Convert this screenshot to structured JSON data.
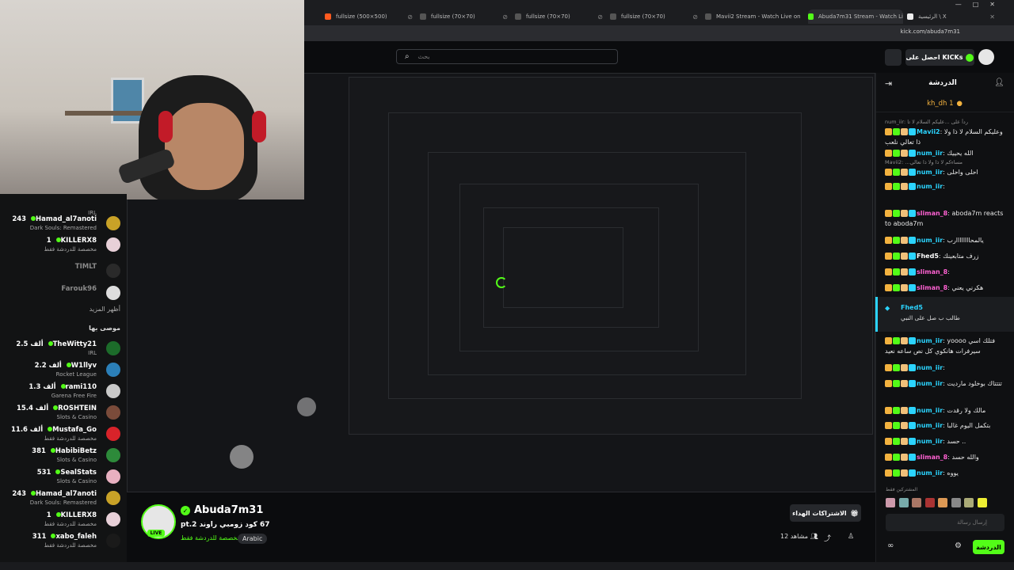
{
  "browser": {
    "tabs": [
      {
        "label": "fullsize (500×500)",
        "color": "#ff5a1f"
      },
      {
        "label": "fullsize (70×70)",
        "color": "#9aa0a6"
      },
      {
        "label": "fullsize (70×70)",
        "color": "#9aa0a6"
      },
      {
        "label": "fullsize (70×70)",
        "color": "#9aa0a6"
      },
      {
        "label": "Mavii2 Stream - Watch Live on",
        "color": "#9aa0a6"
      },
      {
        "label": "Abuda7m31 Stream - Watch Li",
        "color": "#53fc18"
      },
      {
        "label": "الرئيسية \\ X",
        "color": "#ffffff"
      }
    ],
    "url": "kick.com/abuda7m31"
  },
  "header": {
    "search_placeholder": "بحث",
    "get_kicks": "احصل على KICKs"
  },
  "sidebar": {
    "channels": [
      {
        "name": "",
        "viewers": "",
        "category": "IRL",
        "color": "#3a3a3a"
      },
      {
        "name": "Hamad_al7anoti",
        "viewers": "243",
        "category": "Dark Souls: Remastered",
        "color": "#c9a227"
      },
      {
        "name": "KILLERX8",
        "viewers": "1",
        "category": "مخصصة للدردشة فقط",
        "color": "#e8d0d8"
      },
      {
        "name": "TIMLT",
        "viewers": "",
        "category": "",
        "color": "#2a2a2a"
      },
      {
        "name": "Farouk96",
        "viewers": "",
        "category": "",
        "color": "#dddddd"
      }
    ],
    "show_more": "أظهر المزيد",
    "recommended_title": "موصى بها",
    "recommended": [
      {
        "name": "TheWitty21",
        "viewers": "2.5 ألف",
        "category": "IRL",
        "color": "#1c6b2a"
      },
      {
        "name": "W1llyv",
        "viewers": "2.2 ألف",
        "category": "Rocket League",
        "color": "#2b7fb8"
      },
      {
        "name": "rami110",
        "viewers": "1.3 ألف",
        "category": "Garena Free Fire",
        "color": "#c9c9c9"
      },
      {
        "name": "ROSHTEIN",
        "viewers": "15.4 ألف",
        "category": "Slots & Casino",
        "color": "#7a4b3a"
      },
      {
        "name": "Mustafa_Go",
        "viewers": "11.6 ألف",
        "category": "مخصصة للدردشة فقط",
        "color": "#d8232a"
      },
      {
        "name": "HabibiBetz",
        "viewers": "381",
        "category": "Slots & Casino",
        "color": "#2d8a3a"
      },
      {
        "name": "SealStats",
        "viewers": "531",
        "category": "Slots & Casino",
        "color": "#e8b0c0"
      },
      {
        "name": "Hamad_al7anoti",
        "viewers": "243",
        "category": "Dark Souls: Remastered",
        "color": "#c9a227"
      },
      {
        "name": "KILLERX8",
        "viewers": "1",
        "category": "مخصصة للدردشة فقط",
        "color": "#e8d0d8"
      },
      {
        "name": "xabo_faleh",
        "viewers": "311",
        "category": "مخصصة للدردشة فقط",
        "color": "#1a1a1a"
      }
    ]
  },
  "stream": {
    "streamer": "Abuda7m31",
    "live": "LIVE",
    "title": "67 كود زومبي راوند pt.2",
    "category": "مخصصة للدردشة فقط",
    "language": "Arabic",
    "subs_button": "الاشتراكات الهداء",
    "viewers_label": "12 مشاهد",
    "viewer_count": "12"
  },
  "chat": {
    "title": "الدردشة",
    "pinned": "kh_dh 1",
    "messages": [
      {
        "reply": "num_iir: رداً على ...عليكم السلام لا تا",
        "user": "Mavii2",
        "user_color": "#2bd4ff",
        "text": "وعليكم السلام لا ذا ولا ذا تعالي نلعب"
      },
      {
        "reply": "",
        "user": "num_iir",
        "user_color": "#2bd4ff",
        "text": "الله يحييك"
      },
      {
        "reply": "Mavii2: ...مساءكم لا ذا ولا ذا تعالي",
        "user": "num_iir",
        "user_color": "#2bd4ff",
        "text": "احلى واحلى"
      },
      {
        "reply": "",
        "user": "num_iir",
        "user_color": "#2bd4ff",
        "text": ""
      },
      {
        "reply": "",
        "user": "sliman_8",
        "user_color": "#ff61d2",
        "text": "aboda7m reacts to aboda7m"
      },
      {
        "reply": "",
        "user": "num_iir",
        "user_color": "#2bd4ff",
        "text": "يالمحاااااااارب"
      },
      {
        "reply": "",
        "user": "Fhed5",
        "user_color": "#ffffff",
        "text": "زرف متابعينك"
      },
      {
        "reply": "",
        "user": "sliman_8",
        "user_color": "#ff61d2",
        "text": ""
      },
      {
        "reply": "",
        "user": "sliman_8",
        "user_color": "#ff61d2",
        "text": "هكرني يعني"
      },
      {
        "reply": "",
        "user": "num_iir",
        "user_color": "#2bd4ff",
        "text": "yoooo فتلك اسي سيرفرات هانكوي كل نص ساعه نعيد"
      },
      {
        "reply": "",
        "user": "num_iir",
        "user_color": "#2bd4ff",
        "text": ""
      },
      {
        "reply": "",
        "user": "num_iir",
        "user_color": "#2bd4ff",
        "text": "تتتتاك بوخلود مارديت"
      },
      {
        "reply": "",
        "user": "num_iir",
        "user_color": "#2bd4ff",
        "text": "مالك ولا رقدت"
      },
      {
        "reply": "",
        "user": "num_iir",
        "user_color": "#2bd4ff",
        "text": "بتكمل اليوم غالبا"
      },
      {
        "reply": "",
        "user": "num_iir",
        "user_color": "#2bd4ff",
        "text": "حسد .."
      },
      {
        "reply": "",
        "user": "sliman_8",
        "user_color": "#ff61d2",
        "text": "والله حسد"
      },
      {
        "reply": "",
        "user": "num_iir",
        "user_color": "#2bd4ff",
        "text": "يووه"
      }
    ],
    "highlight": {
      "user": "Fhed5",
      "text": "طالب ب صل على النبي"
    },
    "subs_label": "المشتركين فقط",
    "input_placeholder": "إرسال رسالة",
    "send": "الدردشة"
  },
  "colors": {
    "brand": "#53fc18",
    "background": "#0b0c0e"
  }
}
